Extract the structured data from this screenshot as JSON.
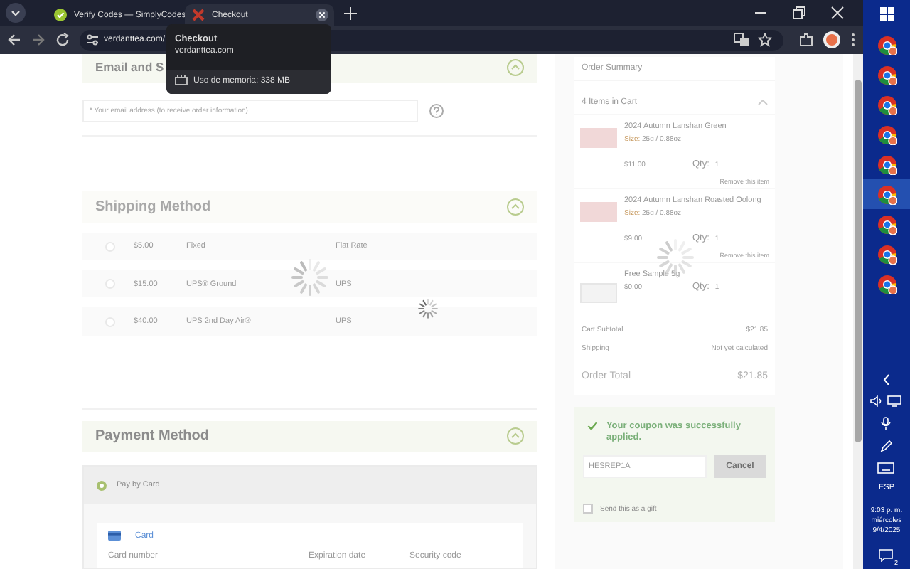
{
  "browser": {
    "tabs": [
      {
        "title": "Verify Codes — SimplyCodes",
        "selected": false
      },
      {
        "title": "Checkout",
        "selected": true
      }
    ],
    "url": "verdanttea.com/",
    "tooltip": {
      "title": "Checkout",
      "domain": "verdanttea.com",
      "memory": "Uso de memoria: 338 MB"
    }
  },
  "email_section": {
    "title": "Email and S",
    "placeholder": "* Your email address (to receive order information)"
  },
  "shipping_section": {
    "title": "Shipping Method",
    "options": [
      {
        "price": "$5.00",
        "name": "Fixed",
        "carrier": "Flat Rate",
        "selected": false
      },
      {
        "price": "$15.00",
        "name": "UPS® Ground",
        "carrier": "UPS",
        "selected": false
      },
      {
        "price": "$40.00",
        "name": "UPS 2nd Day Air®",
        "carrier": "UPS",
        "selected": false
      }
    ]
  },
  "payment_section": {
    "title": "Payment Method",
    "methods": [
      {
        "label": "Pay by Card",
        "selected": true
      }
    ],
    "card": {
      "title": "Card",
      "fields": [
        "Card number",
        "Expiration date",
        "Security code"
      ]
    }
  },
  "order_summary": {
    "title": "Order Summary",
    "cart_title": "4 Items in Cart",
    "items": [
      {
        "name": "2024 Autumn Lanshan Green",
        "size_label": "Size:",
        "size": "25g / 0.88oz",
        "price": "$11.00",
        "qty_label": "Qty:",
        "qty": "1",
        "remove": "Remove this item"
      },
      {
        "name": "2024 Autumn Lanshan Roasted Oolong",
        "size_label": "Size:",
        "size": "25g / 0.88oz",
        "price": "$9.00",
        "qty_label": "Qty:",
        "qty": "1",
        "remove": "Remove this item"
      },
      {
        "name": "Free Sample 5g",
        "price": "$0.00",
        "qty_label": "Qty:",
        "qty": "1"
      }
    ],
    "totals": [
      {
        "label": "Cart Subtotal",
        "value": "$21.85"
      },
      {
        "label": "Shipping",
        "value": "Not yet calculated"
      }
    ],
    "order_total": {
      "label": "Order Total",
      "value": "$21.85"
    },
    "coupon": {
      "message": "Your coupon was successfully applied.",
      "value": "HESREP1A",
      "button": "Cancel"
    },
    "gift": {
      "label": "Send this as a gift",
      "checked": false
    }
  },
  "taskbar": {
    "apps": [
      {
        "selected": false
      },
      {
        "selected": false
      },
      {
        "selected": false
      },
      {
        "selected": false
      },
      {
        "selected": false
      },
      {
        "selected": true
      },
      {
        "selected": false
      },
      {
        "selected": false
      },
      {
        "selected": false
      }
    ],
    "language": "ESP",
    "time": "9:03 p. m.",
    "day": "miércoles",
    "date": "9/4/2025",
    "notifications": "2"
  }
}
